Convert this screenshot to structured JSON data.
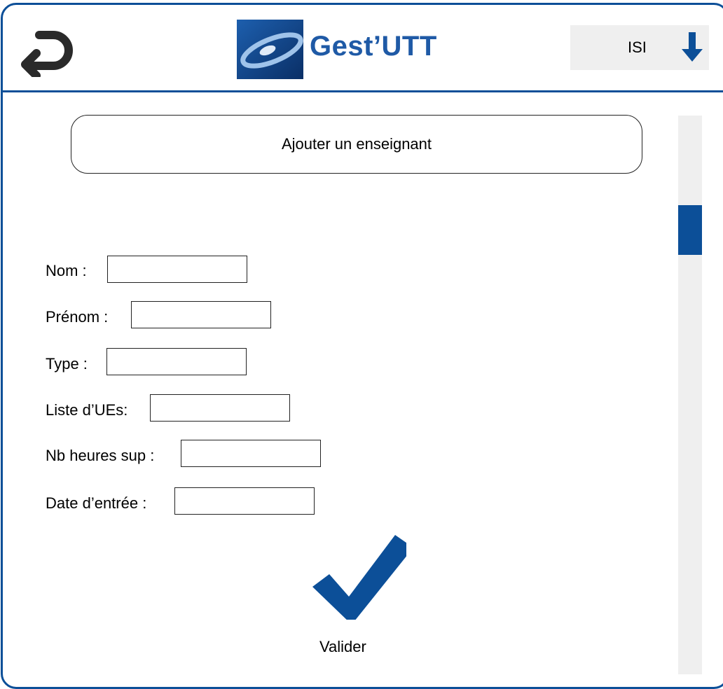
{
  "header": {
    "title": "Gest’UTT",
    "program_select": {
      "selected": "ISI"
    }
  },
  "form": {
    "section_title": "Ajouter un enseignant",
    "fields": {
      "nom": {
        "label": "Nom :",
        "value": ""
      },
      "prenom": {
        "label": "Prénom :",
        "value": ""
      },
      "type": {
        "label": "Type :",
        "value": ""
      },
      "liste_ues": {
        "label": "Liste d’UEs:",
        "value": ""
      },
      "nb_heures_sup": {
        "label": "Nb heures sup :",
        "value": ""
      },
      "date_entree": {
        "label": "Date d’entrée :",
        "value": ""
      }
    },
    "submit_label": "Valider"
  },
  "colors": {
    "accent": "#0c4f98",
    "title": "#1f5aa6",
    "surface": "#efefef"
  },
  "icons": {
    "back": "back-arrow-icon",
    "logo": "gestutt-logo-icon",
    "dropdown": "down-arrow-icon",
    "submit": "checkmark-icon"
  }
}
